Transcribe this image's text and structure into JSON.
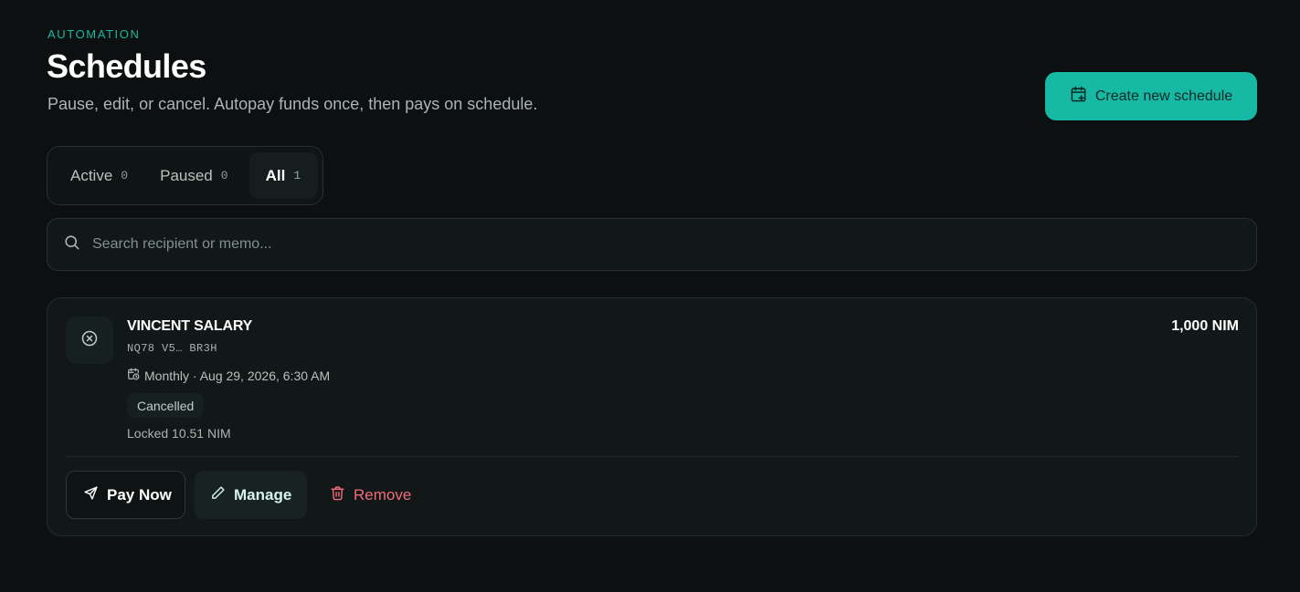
{
  "header": {
    "eyebrow": "AUTOMATION",
    "title": "Schedules",
    "subtitle": "Pause, edit, or cancel. Autopay funds once, then pays on schedule.",
    "create_label": "Create new schedule"
  },
  "tabs": [
    {
      "label": "Active",
      "count": "0",
      "selected": false
    },
    {
      "label": "Paused",
      "count": "0",
      "selected": false
    },
    {
      "label": "All",
      "count": "1",
      "selected": true
    }
  ],
  "search": {
    "placeholder": "Search recipient or memo...",
    "value": ""
  },
  "schedules": [
    {
      "recipient": "VINCENT SALARY",
      "address": "NQ78 V5… BR3H",
      "amount": "1,000 NIM",
      "frequency": "Monthly · Aug 29, 2026, 6:30 AM",
      "status": "Cancelled",
      "locked": "Locked 10.51 NIM",
      "actions": {
        "pay_now": "Pay Now",
        "manage": "Manage",
        "remove": "Remove"
      }
    }
  ],
  "colors": {
    "accent": "#17b9a5",
    "background": "#0c1010",
    "card": "#111817",
    "danger": "#ef6b7a"
  },
  "icons": {
    "create": "calendar-plus-icon",
    "search": "search-icon",
    "status": "x-circle-icon",
    "schedule": "calendar-clock-icon",
    "pay": "send-icon",
    "manage": "pencil-icon",
    "remove": "trash-icon"
  }
}
